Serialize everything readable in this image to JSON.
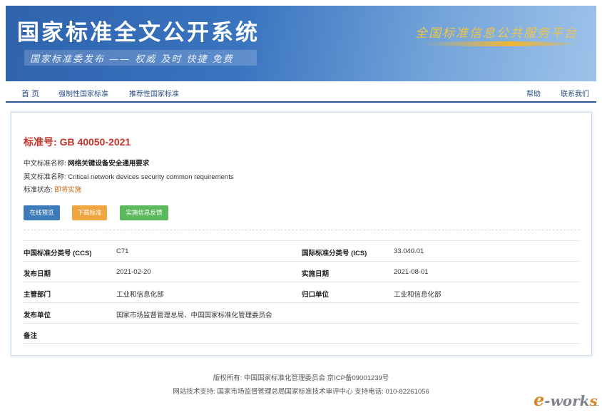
{
  "header": {
    "title": "国家标准全文公开系统",
    "slogan": "国家标准委发布 —— 权威 及时 快捷 免费",
    "platform": "全国标准信息公共服务平台"
  },
  "nav": {
    "home": "首 页",
    "mandatory": "强制性国家标准",
    "recommended": "推荐性国家标准",
    "help": "帮助",
    "contact": "联系我们"
  },
  "standard": {
    "number_label": "标准号:",
    "number": "GB 40050-2021",
    "cn_name_label": "中文标准名称:",
    "cn_name": "网络关键设备安全通用要求",
    "en_name_label": "英文标准名称:",
    "en_name": "Critical network devices security common requirements",
    "status_label": "标准状态:",
    "status": "即将实施"
  },
  "buttons": {
    "preview": "在线预览",
    "download": "下载标准",
    "feedback": "实施信息反馈"
  },
  "details": {
    "ccs_label": "中国标准分类号 (CCS)",
    "ccs": "C71",
    "ics_label": "国际标准分类号 (ICS)",
    "ics": "33.040.01",
    "publish_date_label": "发布日期",
    "publish_date": "2021-02-20",
    "impl_date_label": "实施日期",
    "impl_date": "2021-08-01",
    "dept_label": "主管部门",
    "dept": "工业和信息化部",
    "owner_label": "归口单位",
    "owner": "工业和信息化部",
    "publisher_label": "发布单位",
    "publisher": "国家市场监督管理总局、中国国家标准化管理委员会",
    "remarks_label": "备注",
    "remarks": ""
  },
  "footer": {
    "copyright": "版权所有: 中国国家标准化管理委员会 京ICP备09001239号",
    "support": "网站技术支持: 国家市场监督管理总局国家标准技术审评中心 支持电话: 010-82261056"
  },
  "watermark": {
    "e": "e",
    "mid": "-work",
    "s": "s"
  },
  "colors": {
    "accent_red": "#c4332a",
    "nav_blue": "#2d5a94",
    "status_orange": "#c46b1a",
    "btn_blue": "#3d7cb9",
    "btn_orange": "#f0a640",
    "btn_green": "#5cb85c"
  }
}
